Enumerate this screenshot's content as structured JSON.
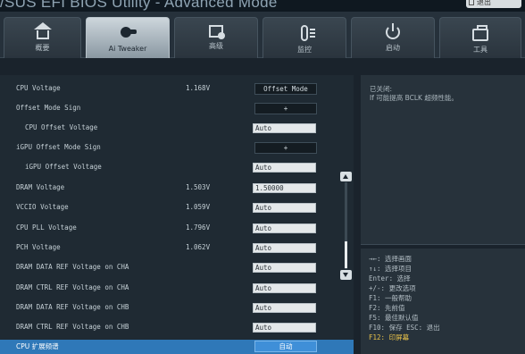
{
  "header": {
    "title": "/SUS EFI BIOS Utility - Advanced Mode",
    "exit_label": "退出"
  },
  "tabs": [
    {
      "label": "概要",
      "icon": "home-icon",
      "active": false
    },
    {
      "label": "Ai Tweaker",
      "icon": "tweaker-icon",
      "active": true
    },
    {
      "label": "高级",
      "icon": "advanced-icon",
      "active": false
    },
    {
      "label": "监控",
      "icon": "monitor-icon",
      "active": false
    },
    {
      "label": "启动",
      "icon": "boot-icon",
      "active": false
    },
    {
      "label": "工具",
      "icon": "tool-icon",
      "active": false
    }
  ],
  "settings": [
    {
      "label": "CPU Voltage",
      "value": "1.168V",
      "control": "button",
      "control_value": "Offset Mode"
    },
    {
      "label": "Offset Mode Sign",
      "value": "",
      "control": "button",
      "control_value": "+"
    },
    {
      "label": "CPU Offset Voltage",
      "value": "",
      "control": "field",
      "control_value": "Auto"
    },
    {
      "label": "iGPU Offset Mode Sign",
      "value": "",
      "control": "button",
      "control_value": "+"
    },
    {
      "label": "iGPU Offset Voltage",
      "value": "",
      "control": "field",
      "control_value": "Auto"
    },
    {
      "label": "DRAM Voltage",
      "value": "1.503V",
      "control": "field",
      "control_value": "1.50000"
    },
    {
      "label": "VCCIO Voltage",
      "value": "1.059V",
      "control": "field",
      "control_value": "Auto"
    },
    {
      "label": "CPU PLL Voltage",
      "value": "1.796V",
      "control": "field",
      "control_value": "Auto"
    },
    {
      "label": "PCH Voltage",
      "value": "1.062V",
      "control": "field",
      "control_value": "Auto"
    },
    {
      "label": "DRAM DATA REF Voltage on CHA",
      "value": "",
      "control": "field",
      "control_value": "Auto"
    },
    {
      "label": "DRAM CTRL REF Voltage on CHA",
      "value": "",
      "control": "field",
      "control_value": "Auto"
    },
    {
      "label": "DRAM DATA REF Voltage on CHB",
      "value": "",
      "control": "field",
      "control_value": "Auto"
    },
    {
      "label": "DRAM CTRL REF Voltage on CHB",
      "value": "",
      "control": "field",
      "control_value": "Auto"
    },
    {
      "label": "CPU 扩展频谱",
      "value": "",
      "control": "button",
      "control_value": "自动"
    }
  ],
  "help": {
    "line1": "已关闭:",
    "line2": "If 可能提高 BCLK 超频性能。"
  },
  "keys": [
    "→←: 选择画面",
    "↑↓: 选择项目",
    "Enter: 选择",
    "+/-: 更改选项",
    "F1: 一般帮助",
    "F2: 先前值",
    "F5: 最佳默认值",
    "F10: 保存  ESC: 退出",
    "F12: 印屏幕"
  ],
  "colors": {
    "accent": "#3f8fd8",
    "highlight_row": "#2f78b8",
    "gold_text": "#e8c24a"
  }
}
